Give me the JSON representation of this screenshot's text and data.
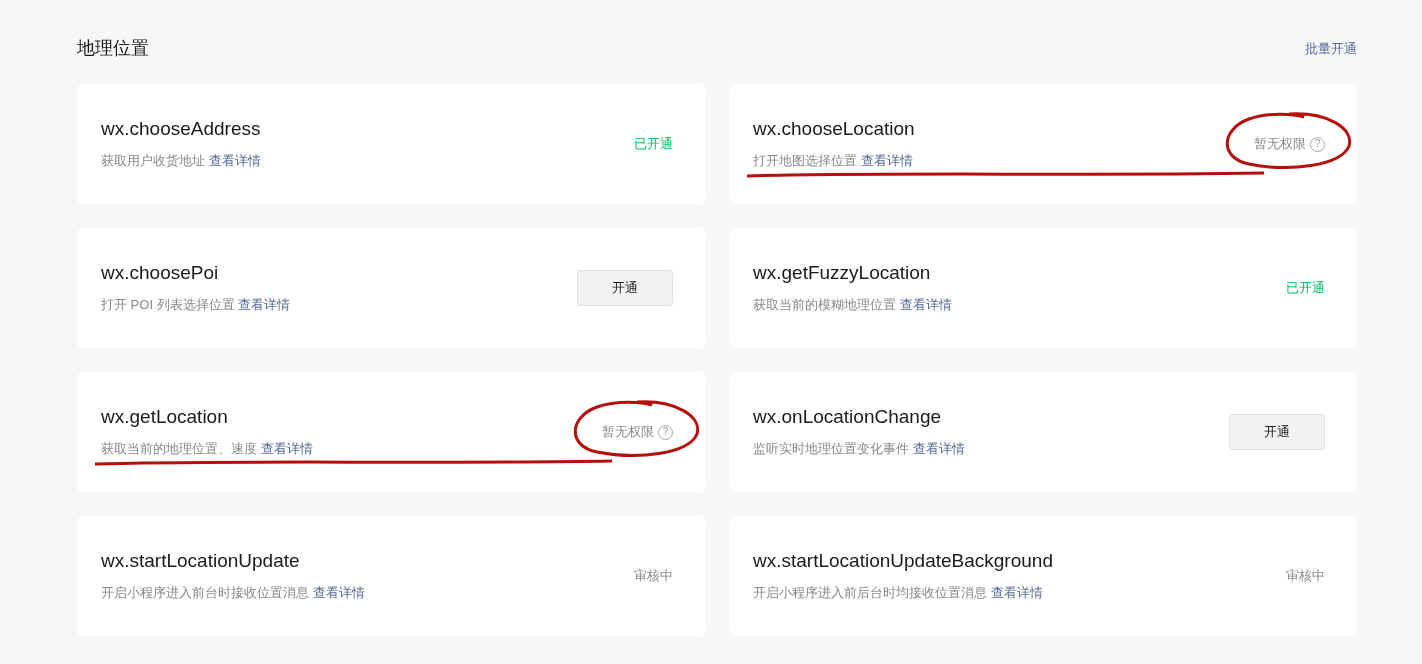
{
  "section": {
    "title": "地理位置",
    "action": "批量开通"
  },
  "cards": [
    {
      "name": "wx.chooseAddress",
      "description": "获取用户收货地址",
      "link": "查看详情",
      "status": {
        "kind": "enabled",
        "text": "已开通"
      },
      "marked": false
    },
    {
      "name": "wx.chooseLocation",
      "description": "打开地图选择位置",
      "link": "查看详情",
      "status": {
        "kind": "no_permission",
        "text": "暂无权限",
        "icon": "?"
      },
      "marked": true
    },
    {
      "name": "wx.choosePoi",
      "description": "打开 POI 列表选择位置",
      "link": "查看详情",
      "status": {
        "kind": "button",
        "text": "开通"
      },
      "marked": false
    },
    {
      "name": "wx.getFuzzyLocation",
      "description": "获取当前的模糊地理位置",
      "link": "查看详情",
      "status": {
        "kind": "enabled",
        "text": "已开通"
      },
      "marked": false
    },
    {
      "name": "wx.getLocation",
      "description": "获取当前的地理位置、速度",
      "link": "查看详情",
      "status": {
        "kind": "no_permission",
        "text": "暂无权限",
        "icon": "?"
      },
      "marked": true
    },
    {
      "name": "wx.onLocationChange",
      "description": "监听实时地理位置变化事件",
      "link": "查看详情",
      "status": {
        "kind": "button",
        "text": "开通"
      },
      "marked": false
    },
    {
      "name": "wx.startLocationUpdate",
      "description": "开启小程序进入前台时接收位置消息",
      "link": "查看详情",
      "status": {
        "kind": "reviewing",
        "text": "审核中"
      },
      "marked": false
    },
    {
      "name": "wx.startLocationUpdateBackground",
      "description": "开启小程序进入前后台时均接收位置消息",
      "link": "查看详情",
      "status": {
        "kind": "reviewing",
        "text": "审核中"
      },
      "marked": false
    }
  ]
}
